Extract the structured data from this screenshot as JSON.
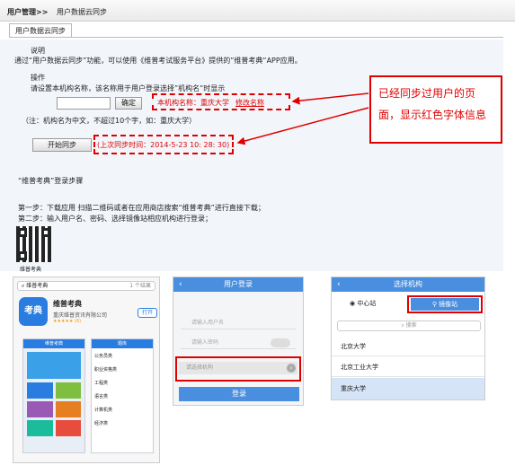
{
  "breadcrumb": {
    "section": "用户管理>>",
    "page": "用户数据云同步"
  },
  "tab": {
    "label": "用户数据云同步"
  },
  "intro": {
    "heading": "说明",
    "text": "通过“用户数据云同步”功能，可以使用《维普考试服务平台》提供的”维普考典“APP应用。"
  },
  "operation": {
    "heading": "操作",
    "prompt": "请设置本机构名称，该名称用于用户登录选择”机构名“时显示",
    "confirm_label": "确定",
    "current_name_prefix": "本机构名称：",
    "current_name": "重庆大学",
    "modify_link": "修改名称",
    "note": "（注：机构名为中文，不超过10个字，如：重庆大学）",
    "sync_label": "开始同步",
    "last_sync": "(上次同步时间：2014-5-23 10: 28: 30)"
  },
  "callout": {
    "line1": "已经同步过用户的页",
    "line2": "面，显示红色字体信息"
  },
  "steps": {
    "title": "“维普考典”登录步骤",
    "step1": "第一步：下载应用 扫描二维码或者在应用商店搜索“维普考典”进行直接下载；",
    "step2": "第二步：输入用户名、密码、选择镜像站相应机构进行登录；",
    "qr_caption": "维普考典"
  },
  "store": {
    "search_text": "维普考典",
    "result_count": "1 个结果",
    "app_name": "维普考典",
    "publisher": "重庆维普资讯有限公司",
    "rating": "★★★★★ (6)",
    "open_label": "打开",
    "icon_text": "考典",
    "preview_left": "维普考典",
    "preview_right": "题库",
    "list": [
      "公务员类",
      "职业资格类",
      "工程类",
      "语言类",
      "计算机类",
      "经济类"
    ]
  },
  "login": {
    "title": "用户登录",
    "username_placeholder": "请输入用户名",
    "password_placeholder": "请输入密码",
    "org_placeholder": "请选择机构",
    "login_label": "登录"
  },
  "org": {
    "title": "选择机构",
    "tab_center": "中心站",
    "tab_mirror": "镜像站",
    "search_placeholder": "搜索",
    "items": [
      "北京大学",
      "北京工业大学",
      "重庆大学"
    ]
  },
  "colors": {
    "accent": "#4a8ee0",
    "alert": "#e10000"
  }
}
